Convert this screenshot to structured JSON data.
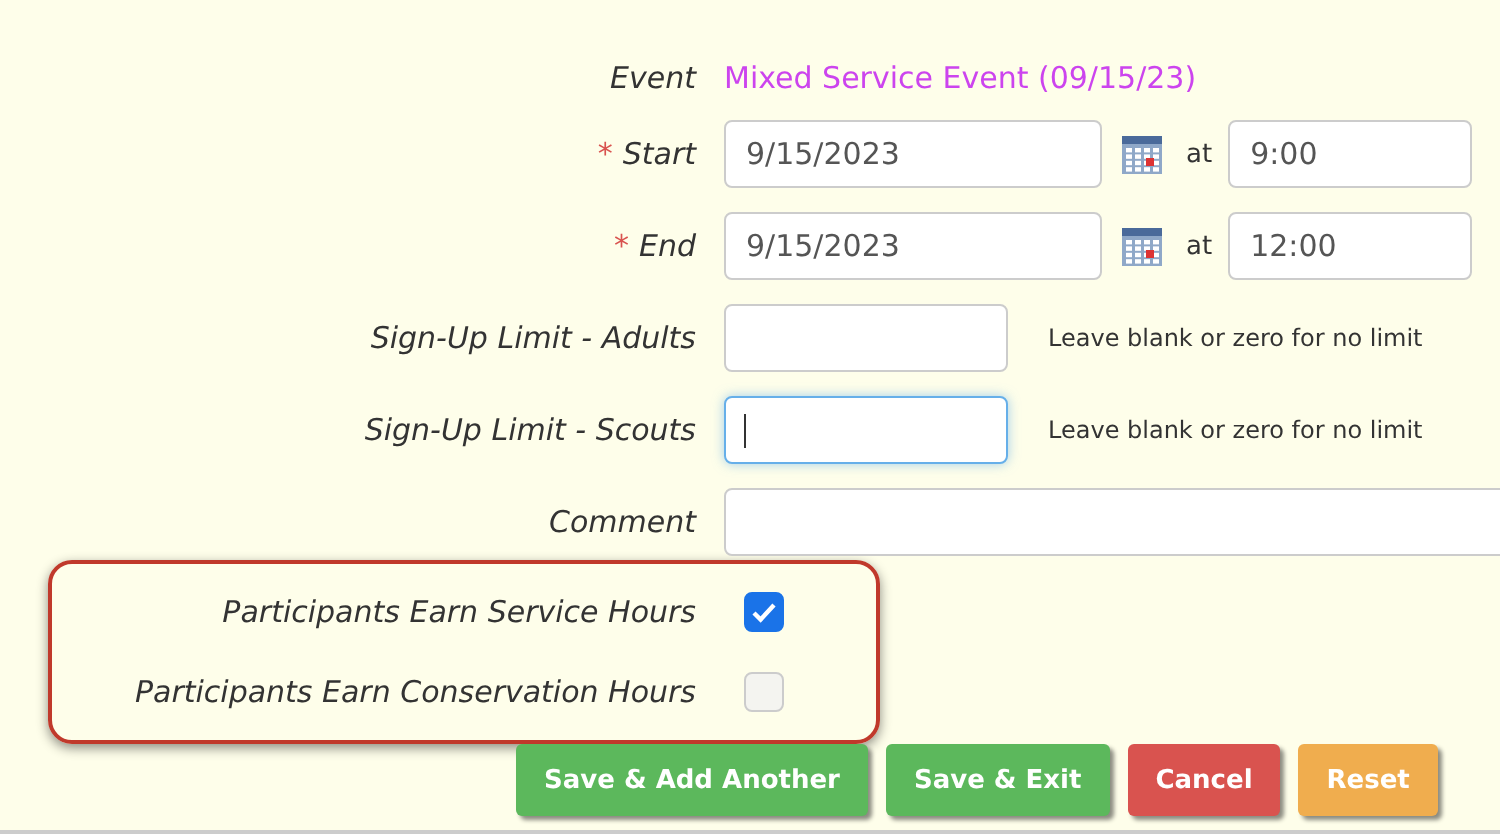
{
  "event": {
    "label": "Event",
    "value": "Mixed Service Event (09/15/23)"
  },
  "datetime_rows": [
    {
      "marker": "*",
      "label": "Start",
      "date": "9/15/2023",
      "at": "at",
      "time": "9:00"
    },
    {
      "marker": "*",
      "label": "End",
      "date": "9/15/2023",
      "at": "at",
      "time": "12:00"
    }
  ],
  "limits": [
    {
      "label": "Sign-Up Limit - Adults",
      "focused": false,
      "hint": "Leave blank or zero for no limit"
    },
    {
      "label": "Sign-Up Limit - Scouts",
      "focused": true,
      "hint": "Leave blank or zero for no limit"
    }
  ],
  "comment": {
    "label": "Comment"
  },
  "checkboxes": [
    {
      "label": "Participants Earn Service Hours",
      "checked": true
    },
    {
      "label": "Participants Earn Conservation Hours",
      "checked": false
    }
  ],
  "buttons": [
    {
      "label": "Save & Add Another",
      "color": "#5cb85c"
    },
    {
      "label": "Save & Exit",
      "color": "#5cb85c"
    },
    {
      "label": "Cancel",
      "color": "#d9534f"
    },
    {
      "label": "Reset",
      "color": "#f0ad4e"
    }
  ]
}
